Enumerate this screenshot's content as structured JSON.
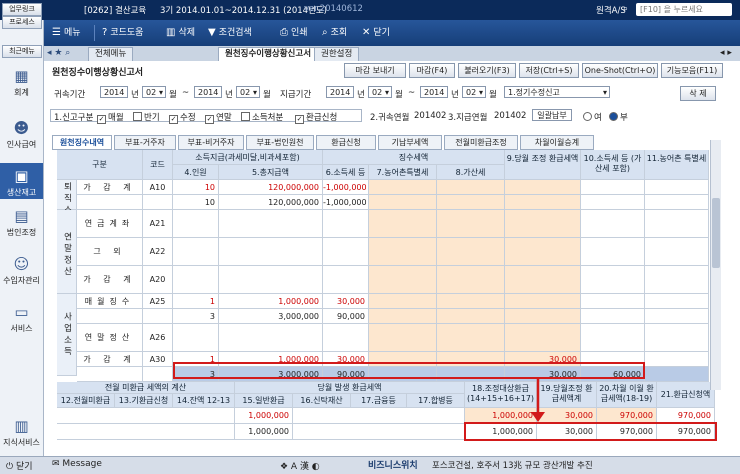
{
  "topbar": {
    "left_links": [
      "업무링크",
      "프로세스",
      "최근메뉴"
    ],
    "company": "[0262] 결산교육",
    "period": "3기 2014.01.01~2014.12.31 (2014년도)",
    "version": "ver.20140612",
    "user": "원격A/S",
    "search_placeholder": "[F10] 을 누르세요"
  },
  "toolbar": {
    "menu": "메뉴",
    "code_help": "코드도움",
    "delete": "삭제",
    "condition_search": "조건검색",
    "print": "인쇄",
    "query": "조회",
    "close": "닫기"
  },
  "leftnav": [
    {
      "label": "회계",
      "icon": "calculator-icon"
    },
    {
      "label": "인사급여",
      "icon": "person-icon"
    },
    {
      "label": "생산재고",
      "icon": "box-icon"
    },
    {
      "label": "법인조정",
      "icon": "building-icon"
    },
    {
      "label": "수입자관리",
      "icon": "people-icon"
    },
    {
      "label": "서비스",
      "icon": "monitor-icon"
    },
    {
      "label": "지식서비스",
      "icon": "book-icon"
    }
  ],
  "tabs": {
    "all_menu": "전체메뉴",
    "active": "원천징수이행상황신고서",
    "settings": "권한설정"
  },
  "content": {
    "title": "원천징수이행상황신고서",
    "actions": [
      "마감 보내기",
      "마감(F4)",
      "불러오기(F3)",
      "저장(Ctrl+S)",
      "One-Shot(Ctrl+O)",
      "기능모음(F11)"
    ],
    "action_delete": "삭 제",
    "filter1": {
      "label1": "귀속기간",
      "from_year": "2014",
      "from_year_suffix": "년",
      "from_month": "02",
      "from_month_suffix": "월",
      "tilde": "~",
      "to_year": "2014",
      "to_year_suffix": "년",
      "to_month": "02",
      "to_month_suffix": "월",
      "label2": "지급기간",
      "pay_from_year": "2014",
      "pay_from_year_suffix": "년",
      "pay_from_month": "02",
      "pay_from_month_suffix": "월",
      "pay_tilde": "~",
      "pay_to_year": "2014",
      "pay_to_year_suffix": "년",
      "pay_to_month": "02",
      "pay_to_month_suffix": "월",
      "report_type": "1.정기수정신고"
    },
    "filter2": {
      "report_kind": "1.신고구분",
      "chk_monthly": "매월",
      "chk_half": "반기",
      "chk_modify": "수정",
      "chk_annual": "연말",
      "chk_income": "소득처분",
      "chk_refund": "환급신청",
      "item1_label": "2.귀속연월",
      "item1_value": "201402",
      "item2_label": "3.지급연월",
      "item2_value": "201402",
      "batch_label": "일괄납부",
      "radio_yes": "여",
      "radio_no": "부"
    },
    "subtabs": [
      "원천징수내역",
      "부표-거주자",
      "부표-비거주자",
      "부표-법인원천",
      "환급신청",
      "기납부세액",
      "전월미환급조정",
      "차월이월승계"
    ]
  },
  "grid": {
    "h_group": "구분",
    "h_code": "코드",
    "h_income": "소득지급(과세미달,비과세포함)",
    "h_withholding": "징수세액",
    "h_col1": "4.인원",
    "h_col2": "5.총지급액",
    "h_col3": "6.소득세 등",
    "h_col4": "7.농어촌특별세",
    "h_col5": "8.가산세",
    "h_col9": "9.당월 조정 환급세액",
    "h_col10": "10.소득세 등 (가산세 포함)",
    "h_col11": "11.농어촌 특별세",
    "side_labels": [
      "퇴직소득",
      "연말정산",
      "사업소득"
    ],
    "rows": [
      {
        "label": "가 감 계",
        "code": "A10",
        "persons": "10",
        "total": "120,000,000",
        "tax": "-1,000,000",
        "red": true
      },
      {
        "label": "",
        "code": "",
        "persons": "10",
        "total": "120,000,000",
        "tax": "-1,000,000",
        "red": false
      },
      {
        "label": "연금계좌",
        "code": "A21",
        "persons": "",
        "total": "",
        "tax": "",
        "red": false
      },
      {
        "label": "그 외",
        "code": "A22",
        "persons": "",
        "total": "",
        "tax": "",
        "red": false
      },
      {
        "label": "가 감 계",
        "code": "A20",
        "persons": "",
        "total": "",
        "tax": "",
        "red": false
      },
      {
        "label": "매월징수",
        "code": "A25",
        "persons": "1",
        "total": "1,000,000",
        "tax": "30,000",
        "red": true
      },
      {
        "label": "",
        "code": "",
        "persons": "3",
        "total": "3,000,000",
        "tax": "90,000",
        "red": false
      },
      {
        "label": "연말정산",
        "code": "A26",
        "persons": "",
        "total": "",
        "tax": "",
        "red": false
      },
      {
        "label": "가 감 계",
        "code": "A30",
        "persons": "1",
        "total": "1,000,000",
        "tax": "30,000",
        "red": true,
        "col9": "30,000"
      },
      {
        "label": "",
        "code": "",
        "persons": "3",
        "total": "3,000,000",
        "tax": "90,000",
        "red": false,
        "col9": "30,000",
        "col10": "60,000",
        "highlight": true
      }
    ]
  },
  "bottomgrid": {
    "h_prev": "전월 미환급 세액의 계산",
    "h_curr": "당월 발생 환급세액",
    "h_c12": "12.전월미환급",
    "h_c13": "13.기환급신청",
    "h_c14": "14.잔액 12-13",
    "h_c15": "15.일반환급",
    "h_c16": "16.신탁재산",
    "h_c17a": "17.금융등",
    "h_c17b": "17.합병등",
    "h_c18": "18.조정대상환급 (14+15+16+17)",
    "h_c19": "19.당월조정 환급세액계",
    "h_c20": "20.차월 이월 환급세액(18-19)",
    "h_c21": "21.환급신청액",
    "row1": {
      "c15": "1,000,000",
      "c18": "1,000,000",
      "c19": "30,000",
      "c20": "970,000",
      "c21": "970,000"
    },
    "row2": {
      "c15": "1,000,000",
      "c18": "1,000,000",
      "c19": "30,000",
      "c20": "970,000",
      "c21": "970,000"
    }
  },
  "bottombar": {
    "close": "닫기",
    "message": "Message",
    "biz": "비즈니스위치",
    "notice": "포스코건설, 호주서 13兆 규모 광산개발 추진"
  },
  "colors": {
    "navy": "#0b2a5a",
    "toolbar": "#1f4c8f",
    "header_cell": "#d7e2f1",
    "peach": "#fde7cf",
    "red_highlight": "#d21a1a"
  }
}
